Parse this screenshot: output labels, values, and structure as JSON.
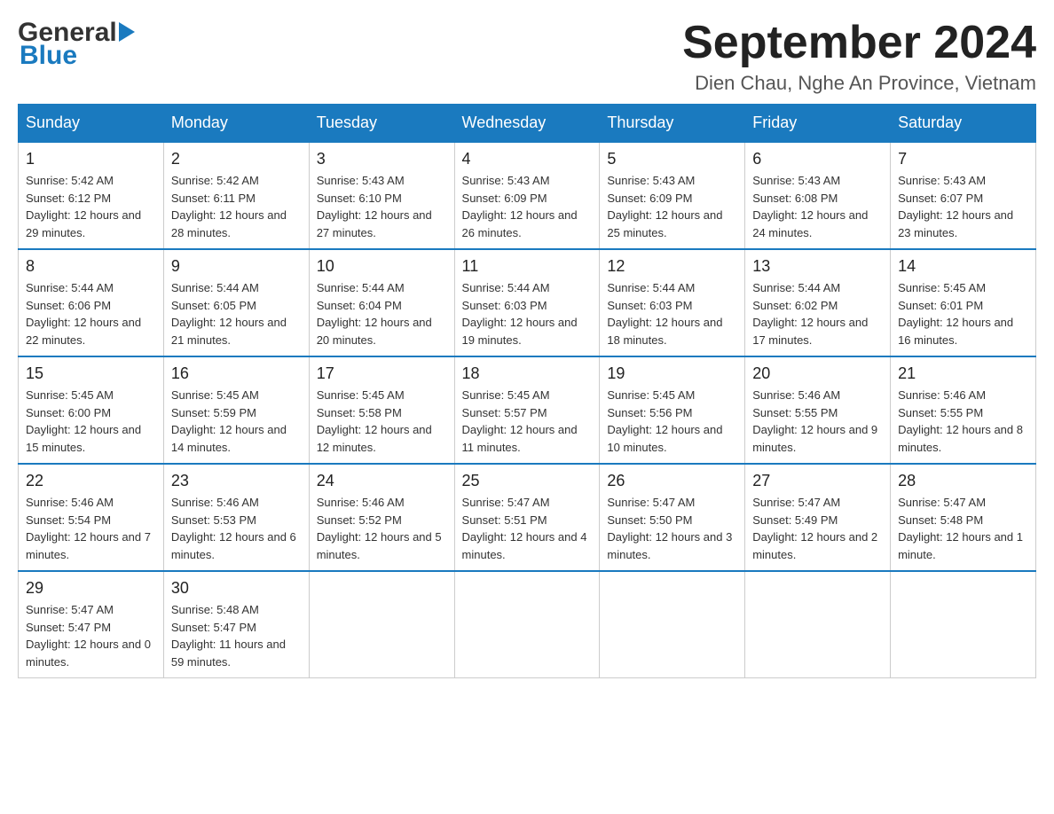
{
  "header": {
    "logo": {
      "general": "General",
      "blue": "Blue",
      "arrow": "▶"
    },
    "title": "September 2024",
    "location": "Dien Chau, Nghe An Province, Vietnam"
  },
  "calendar": {
    "days_of_week": [
      "Sunday",
      "Monday",
      "Tuesday",
      "Wednesday",
      "Thursday",
      "Friday",
      "Saturday"
    ],
    "weeks": [
      [
        {
          "day": "1",
          "sunrise": "Sunrise: 5:42 AM",
          "sunset": "Sunset: 6:12 PM",
          "daylight": "Daylight: 12 hours and 29 minutes."
        },
        {
          "day": "2",
          "sunrise": "Sunrise: 5:42 AM",
          "sunset": "Sunset: 6:11 PM",
          "daylight": "Daylight: 12 hours and 28 minutes."
        },
        {
          "day": "3",
          "sunrise": "Sunrise: 5:43 AM",
          "sunset": "Sunset: 6:10 PM",
          "daylight": "Daylight: 12 hours and 27 minutes."
        },
        {
          "day": "4",
          "sunrise": "Sunrise: 5:43 AM",
          "sunset": "Sunset: 6:09 PM",
          "daylight": "Daylight: 12 hours and 26 minutes."
        },
        {
          "day": "5",
          "sunrise": "Sunrise: 5:43 AM",
          "sunset": "Sunset: 6:09 PM",
          "daylight": "Daylight: 12 hours and 25 minutes."
        },
        {
          "day": "6",
          "sunrise": "Sunrise: 5:43 AM",
          "sunset": "Sunset: 6:08 PM",
          "daylight": "Daylight: 12 hours and 24 minutes."
        },
        {
          "day": "7",
          "sunrise": "Sunrise: 5:43 AM",
          "sunset": "Sunset: 6:07 PM",
          "daylight": "Daylight: 12 hours and 23 minutes."
        }
      ],
      [
        {
          "day": "8",
          "sunrise": "Sunrise: 5:44 AM",
          "sunset": "Sunset: 6:06 PM",
          "daylight": "Daylight: 12 hours and 22 minutes."
        },
        {
          "day": "9",
          "sunrise": "Sunrise: 5:44 AM",
          "sunset": "Sunset: 6:05 PM",
          "daylight": "Daylight: 12 hours and 21 minutes."
        },
        {
          "day": "10",
          "sunrise": "Sunrise: 5:44 AM",
          "sunset": "Sunset: 6:04 PM",
          "daylight": "Daylight: 12 hours and 20 minutes."
        },
        {
          "day": "11",
          "sunrise": "Sunrise: 5:44 AM",
          "sunset": "Sunset: 6:03 PM",
          "daylight": "Daylight: 12 hours and 19 minutes."
        },
        {
          "day": "12",
          "sunrise": "Sunrise: 5:44 AM",
          "sunset": "Sunset: 6:03 PM",
          "daylight": "Daylight: 12 hours and 18 minutes."
        },
        {
          "day": "13",
          "sunrise": "Sunrise: 5:44 AM",
          "sunset": "Sunset: 6:02 PM",
          "daylight": "Daylight: 12 hours and 17 minutes."
        },
        {
          "day": "14",
          "sunrise": "Sunrise: 5:45 AM",
          "sunset": "Sunset: 6:01 PM",
          "daylight": "Daylight: 12 hours and 16 minutes."
        }
      ],
      [
        {
          "day": "15",
          "sunrise": "Sunrise: 5:45 AM",
          "sunset": "Sunset: 6:00 PM",
          "daylight": "Daylight: 12 hours and 15 minutes."
        },
        {
          "day": "16",
          "sunrise": "Sunrise: 5:45 AM",
          "sunset": "Sunset: 5:59 PM",
          "daylight": "Daylight: 12 hours and 14 minutes."
        },
        {
          "day": "17",
          "sunrise": "Sunrise: 5:45 AM",
          "sunset": "Sunset: 5:58 PM",
          "daylight": "Daylight: 12 hours and 12 minutes."
        },
        {
          "day": "18",
          "sunrise": "Sunrise: 5:45 AM",
          "sunset": "Sunset: 5:57 PM",
          "daylight": "Daylight: 12 hours and 11 minutes."
        },
        {
          "day": "19",
          "sunrise": "Sunrise: 5:45 AM",
          "sunset": "Sunset: 5:56 PM",
          "daylight": "Daylight: 12 hours and 10 minutes."
        },
        {
          "day": "20",
          "sunrise": "Sunrise: 5:46 AM",
          "sunset": "Sunset: 5:55 PM",
          "daylight": "Daylight: 12 hours and 9 minutes."
        },
        {
          "day": "21",
          "sunrise": "Sunrise: 5:46 AM",
          "sunset": "Sunset: 5:55 PM",
          "daylight": "Daylight: 12 hours and 8 minutes."
        }
      ],
      [
        {
          "day": "22",
          "sunrise": "Sunrise: 5:46 AM",
          "sunset": "Sunset: 5:54 PM",
          "daylight": "Daylight: 12 hours and 7 minutes."
        },
        {
          "day": "23",
          "sunrise": "Sunrise: 5:46 AM",
          "sunset": "Sunset: 5:53 PM",
          "daylight": "Daylight: 12 hours and 6 minutes."
        },
        {
          "day": "24",
          "sunrise": "Sunrise: 5:46 AM",
          "sunset": "Sunset: 5:52 PM",
          "daylight": "Daylight: 12 hours and 5 minutes."
        },
        {
          "day": "25",
          "sunrise": "Sunrise: 5:47 AM",
          "sunset": "Sunset: 5:51 PM",
          "daylight": "Daylight: 12 hours and 4 minutes."
        },
        {
          "day": "26",
          "sunrise": "Sunrise: 5:47 AM",
          "sunset": "Sunset: 5:50 PM",
          "daylight": "Daylight: 12 hours and 3 minutes."
        },
        {
          "day": "27",
          "sunrise": "Sunrise: 5:47 AM",
          "sunset": "Sunset: 5:49 PM",
          "daylight": "Daylight: 12 hours and 2 minutes."
        },
        {
          "day": "28",
          "sunrise": "Sunrise: 5:47 AM",
          "sunset": "Sunset: 5:48 PM",
          "daylight": "Daylight: 12 hours and 1 minute."
        }
      ],
      [
        {
          "day": "29",
          "sunrise": "Sunrise: 5:47 AM",
          "sunset": "Sunset: 5:47 PM",
          "daylight": "Daylight: 12 hours and 0 minutes."
        },
        {
          "day": "30",
          "sunrise": "Sunrise: 5:48 AM",
          "sunset": "Sunset: 5:47 PM",
          "daylight": "Daylight: 11 hours and 59 minutes."
        },
        null,
        null,
        null,
        null,
        null
      ]
    ]
  }
}
